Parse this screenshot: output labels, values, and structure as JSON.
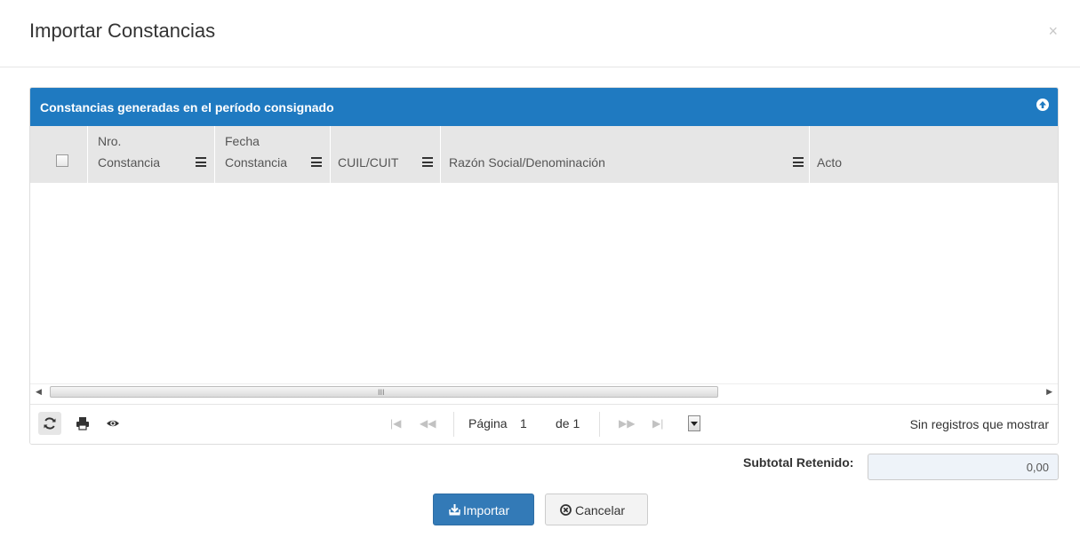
{
  "modal": {
    "title": "Importar Constancias",
    "close_glyph": "×"
  },
  "grid": {
    "caption": "Constancias generadas en el período consignado",
    "columns": [
      {
        "line1": "Nro.",
        "line2": "Constancia"
      },
      {
        "line1": "Fecha",
        "line2": "Constancia"
      },
      {
        "label": "CUIL/CUIT"
      },
      {
        "label": "Razón Social/Denominación"
      },
      {
        "label": "Acto"
      }
    ],
    "scroll_grip": "III",
    "rows": []
  },
  "pager": {
    "page_label": "Página",
    "page_value": "1",
    "of_label": "de 1",
    "info": "Sin registros que mostrar"
  },
  "subtotal": {
    "label": "Subtotal Retenido:",
    "value": "0,00"
  },
  "buttons": {
    "import_label": "Importar",
    "cancel_label": "Cancelar"
  },
  "colors": {
    "caption_bg": "#1f7ac1",
    "header_bg": "#e6e6e6",
    "primary": "#337ab7"
  }
}
